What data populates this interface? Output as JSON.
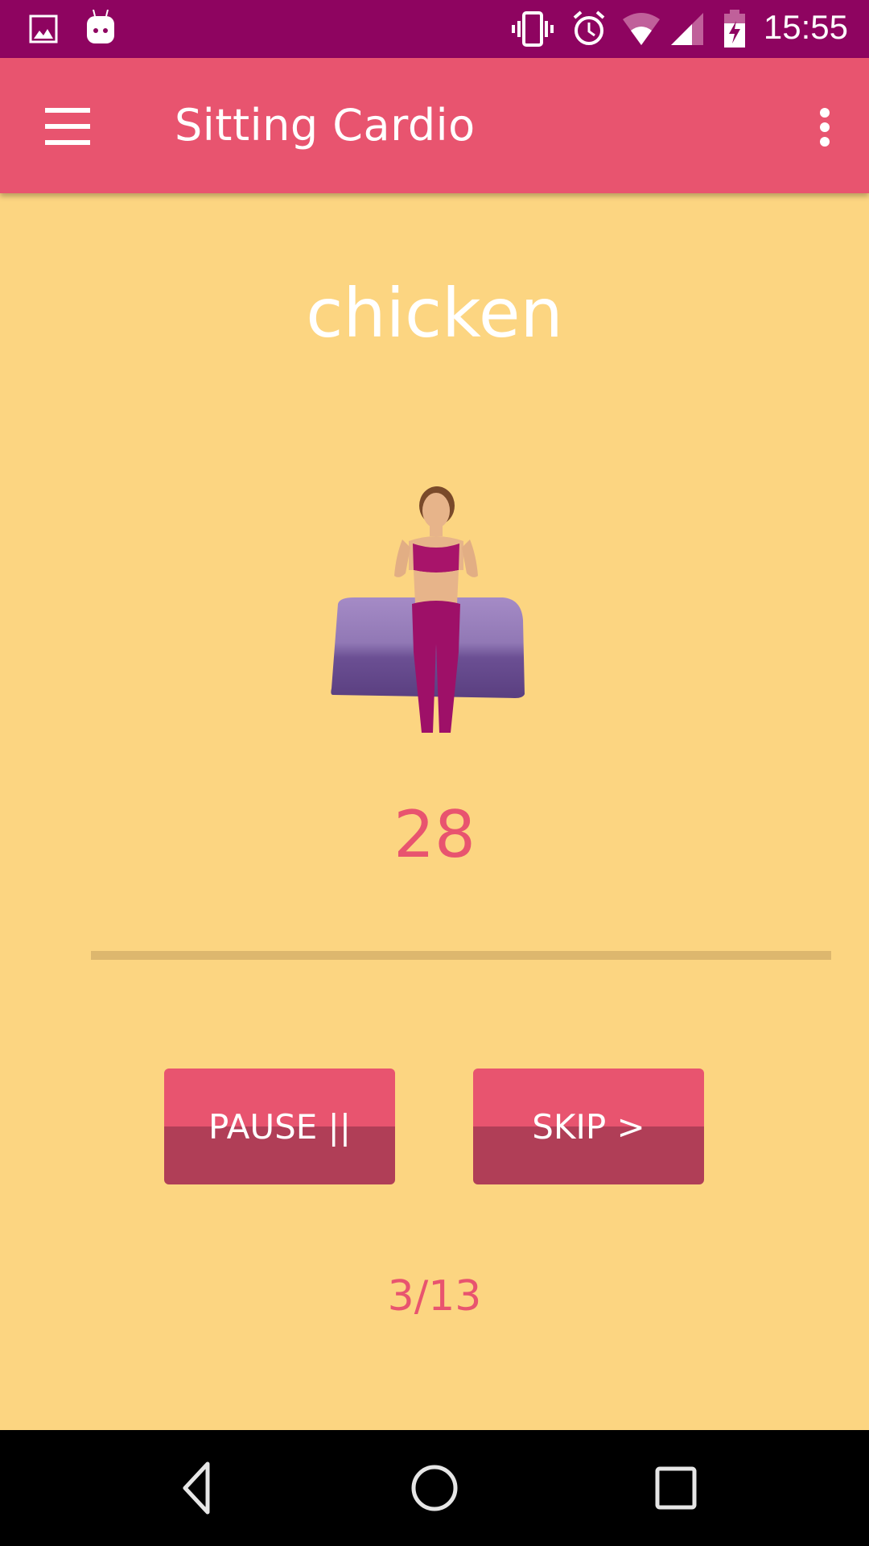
{
  "status_bar": {
    "time": "15:55",
    "left_icons": [
      "gallery-icon",
      "android-debug-icon"
    ],
    "right_icons": [
      "vibrate-icon",
      "alarm-icon",
      "wifi-icon",
      "signal-icon",
      "battery-charging-icon"
    ]
  },
  "app_bar": {
    "title": "Sitting Cardio",
    "menu_icon": "hamburger-menu-icon",
    "overflow_icon": "more-vert-icon"
  },
  "exercise": {
    "name": "chicken",
    "image": "woman-sitting-on-bench-illustration",
    "timer": "28",
    "progress_fraction": 0.0
  },
  "controls": {
    "pause_label": "PAUSE ||",
    "skip_label": "SKIP >"
  },
  "step_counter": "3/13",
  "nav_bar": {
    "back_icon": "back-icon",
    "home_icon": "home-icon",
    "recents_icon": "recents-icon"
  },
  "colors": {
    "status_bar": "#8E0460",
    "app_bar": "#E8546F",
    "background": "#FCD581",
    "button_top": "#E8546F",
    "button_bottom": "#B03E57",
    "progress_track": "#DDB76E",
    "accent_text": "#E8546F"
  }
}
